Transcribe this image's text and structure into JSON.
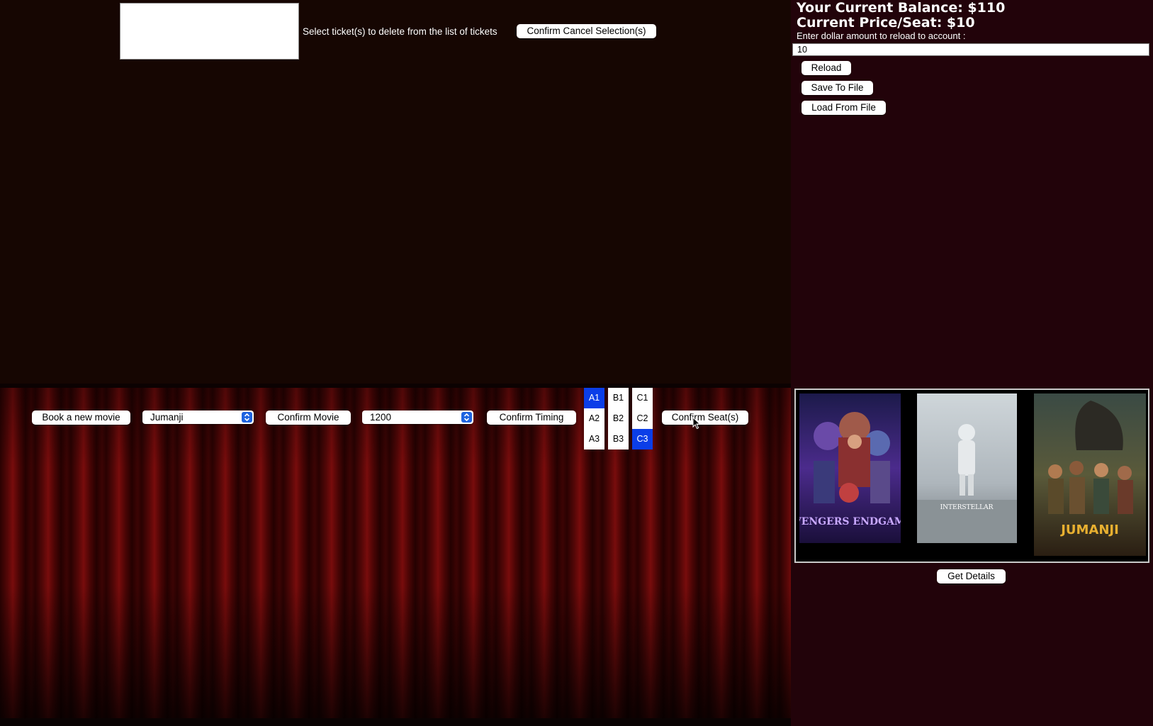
{
  "ticket_cancel": {
    "list_items": [],
    "label": "Select ticket(s) to delete from the list of tickets",
    "confirm_button": "Confirm Cancel Selection(s)"
  },
  "account": {
    "balance_text": "Your Current Balance: $110",
    "price_text": "Current Price/Seat: $10",
    "reload_prompt": "Enter dollar amount to reload to account :",
    "reload_value": "10",
    "reload_button": "Reload",
    "save_button": "Save To File",
    "load_button": "Load From File"
  },
  "booking": {
    "book_button": "Book a new movie",
    "movie_select": "Jumanji",
    "confirm_movie_button": "Confirm Movie",
    "timing_select": "1200",
    "confirm_timing_button": "Confirm Timing",
    "seats": [
      [
        "A1",
        "A2",
        "A3"
      ],
      [
        "B1",
        "B2",
        "B3"
      ],
      [
        "C1",
        "C2",
        "C3"
      ]
    ],
    "selected_seats": [
      "A1",
      "C3"
    ],
    "confirm_seats_button": "Confirm Seat(s)"
  },
  "posters": {
    "items": [
      "avengers-endgame-poster",
      "interstellar-poster",
      "jumanji-poster"
    ],
    "get_details_button": "Get Details",
    "poster_text": {
      "endgame": "AVENGERS ENDGAME",
      "interstellar": "INTERSTELLAR",
      "jumanji": "JUMANJI"
    }
  },
  "colors": {
    "background": "#160602",
    "right_panel": "#22030a",
    "selected_seat": "#0b3ee8",
    "select_arrow": "#1f64e0"
  }
}
